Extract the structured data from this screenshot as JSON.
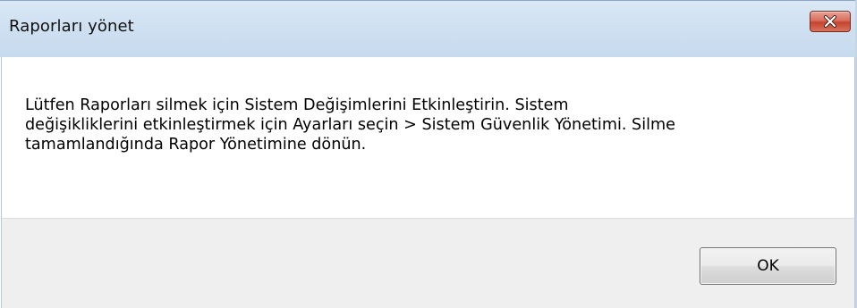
{
  "window": {
    "title": "Raporları yönet",
    "close_label": "×"
  },
  "message": {
    "text": "Lütfen Raporları silmek için Sistem Değişimlerini Etkinleştirin. Sistem\ndeğişikliklerini etkinleştirmek için Ayarları seçin > Sistem Güvenlik Yönetimi. Silme\ntamamlandığında Rapor Yönetimine dönün."
  },
  "buttons": {
    "ok_label": "OK"
  },
  "colors": {
    "titlebar": "#cfe0f1",
    "close_button": "#c4442f",
    "footer": "#efefef"
  }
}
